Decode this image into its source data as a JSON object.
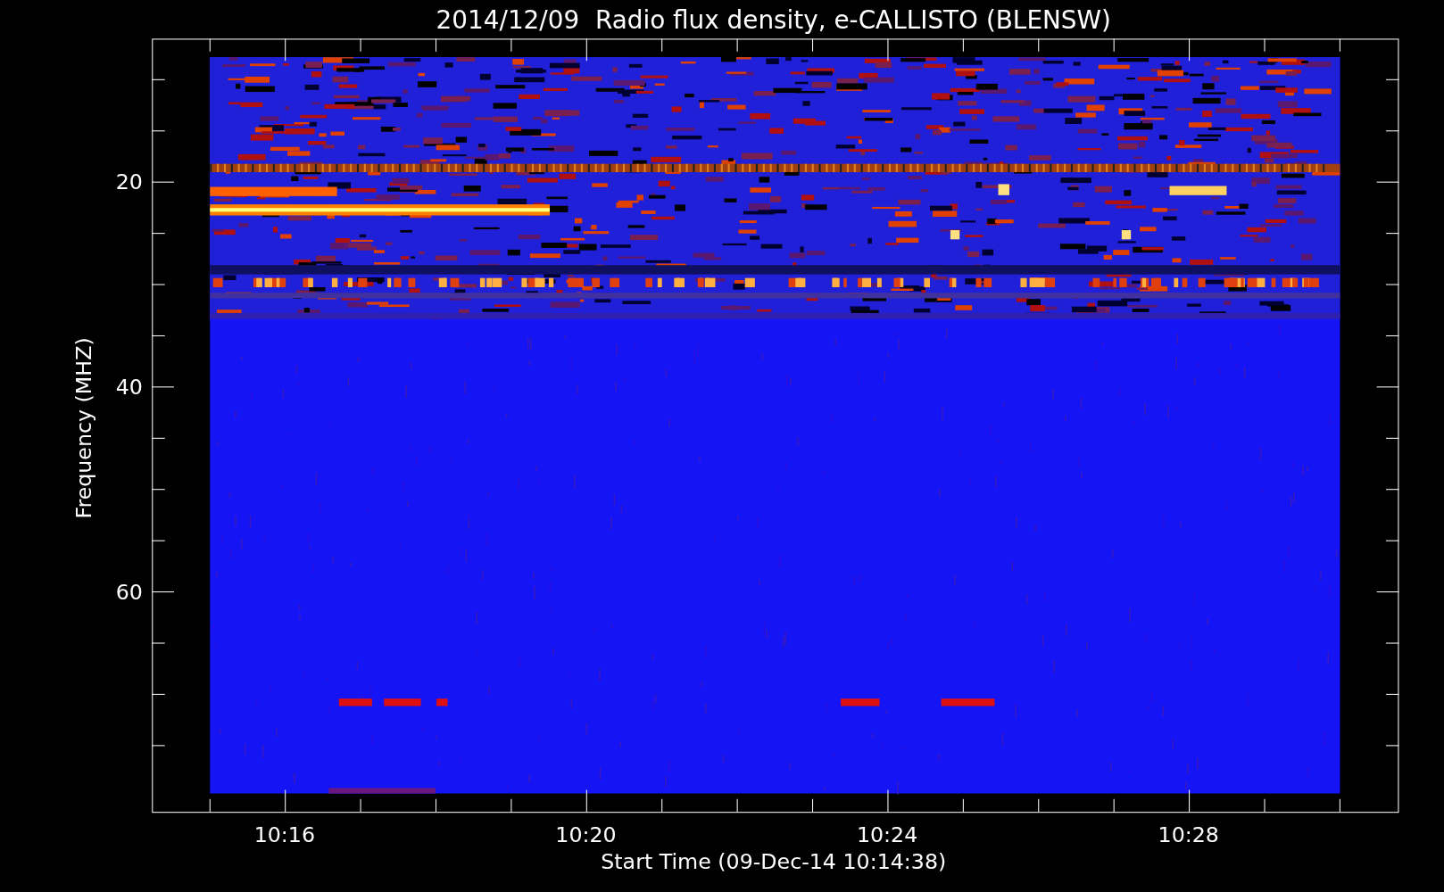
{
  "title": "2014/12/09  Radio flux density, e-CALLISTO (BLENSW)",
  "ylabel": "Frequency (MHZ)",
  "xlabel": "Start Time (09-Dec-14 10:14:38)",
  "y_tick_labels": [
    "20",
    "40",
    "60"
  ],
  "x_tick_labels": [
    "10:16",
    "10:20",
    "10:24",
    "10:28"
  ]
}
